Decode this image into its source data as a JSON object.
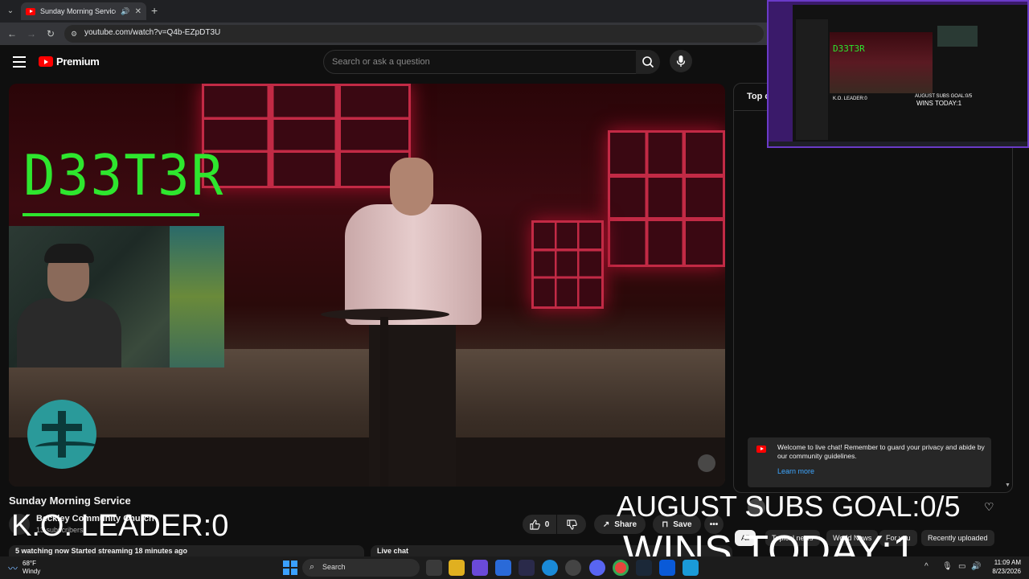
{
  "browser": {
    "tab_title": "Sunday Morning Service - Y",
    "url": "youtube.com/watch?v=Q4b-EZpDT3U"
  },
  "youtube": {
    "logo_text": "Premium",
    "search_placeholder": "Search or ask a question"
  },
  "video": {
    "title": "Sunday Morning Service",
    "channel_name": "Beckley Community Church",
    "channel_subscribers": "13 subscribers",
    "like_count": "0",
    "share_label": "Share",
    "save_label": "Save",
    "status": "5 watching now  Started streaming 18 minutes ago"
  },
  "overlay": {
    "streamer_tag": "D33T3R",
    "ko_leader": "K.O. LEADER:0",
    "subs_goal": "AUGUST SUBS GOAL:0/5",
    "wins_today": "WINS TODAY:1"
  },
  "chat": {
    "header": "Top c",
    "welcome_message": "Welcome to live chat! Remember to guard your privacy and abide by our community guidelines.",
    "learn_more": "Learn more",
    "live_chat_label": "Live chat",
    "chips": [
      "All",
      "Topical news",
      "World News",
      "For you",
      "Recently uploaded"
    ]
  },
  "pip": {
    "tag": "D33T3R",
    "ko": "K.O. LEADER:0",
    "goal": "AUGUST SUBS GOAL:0/5",
    "wins": "WINS TODAY:1"
  },
  "taskbar": {
    "temperature": "68°F",
    "weather_desc": "Windy",
    "search_label": "Search",
    "time": "11:09 AM",
    "date": "8/23/2026"
  },
  "colors": {
    "youtube_red": "#ff0000",
    "overlay_green": "#2ee62e",
    "link_blue": "#3ea6ff"
  }
}
